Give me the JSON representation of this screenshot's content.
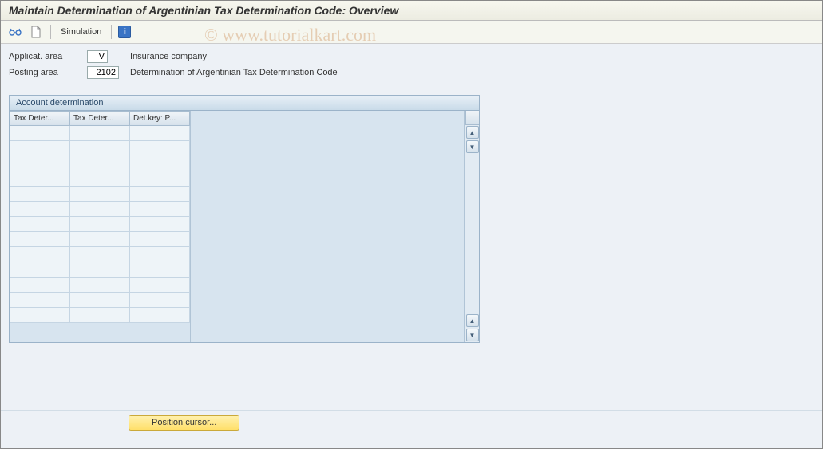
{
  "title": "Maintain Determination of Argentinian Tax Determination Code: Overview",
  "toolbar": {
    "simulation_label": "Simulation",
    "info_glyph": "i"
  },
  "form": {
    "applic_label": "Applicat. area",
    "applic_value": "V",
    "applic_desc": "Insurance company",
    "posting_label": "Posting area",
    "posting_value": "2102",
    "posting_desc": "Determination of Argentinian Tax Determination Code"
  },
  "panel": {
    "header": "Account determination",
    "columns": [
      "Tax Deter...",
      "Tax Deter...",
      "Det.key: P..."
    ],
    "row_count": 13
  },
  "bottom": {
    "position_cursor": "Position cursor..."
  },
  "watermark": "© www.tutorialkart.com"
}
